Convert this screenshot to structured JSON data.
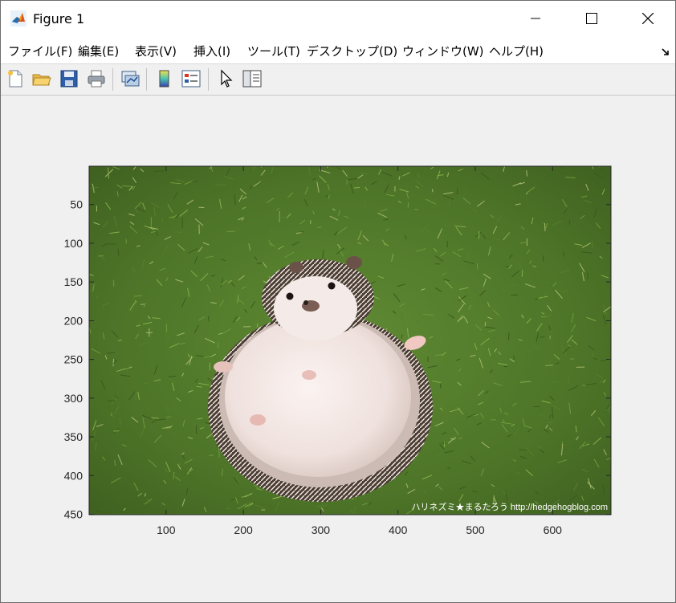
{
  "window": {
    "title": "Figure 1",
    "icon": "matlab-logo-icon",
    "controls": [
      "minimize-icon",
      "maximize-icon",
      "close-icon"
    ]
  },
  "menu": {
    "items": [
      {
        "label": "ファイル(F)"
      },
      {
        "label": "編集(E)"
      },
      {
        "label": "表示(V)"
      },
      {
        "label": "挿入(I)"
      },
      {
        "label": "ツール(T)"
      },
      {
        "label": "デスクトップ(D)"
      },
      {
        "label": "ウィンドウ(W)"
      },
      {
        "label": "ヘルプ(H)"
      }
    ],
    "dock_icon": "dock-arrow-icon"
  },
  "toolbar": {
    "buttons": [
      {
        "name": "new-figure-button",
        "icon": "new-document-icon"
      },
      {
        "name": "open-file-button",
        "icon": "open-folder-icon"
      },
      {
        "name": "save-figure-button",
        "icon": "floppy-disk-icon"
      },
      {
        "name": "print-figure-button",
        "icon": "printer-icon"
      },
      {
        "name": "link-plot-button",
        "icon": "link-plot-icon"
      },
      {
        "name": "insert-colorbar-button",
        "icon": "colorbar-icon"
      },
      {
        "name": "insert-legend-button",
        "icon": "legend-icon"
      },
      {
        "name": "edit-plot-button",
        "icon": "arrow-cursor-icon"
      },
      {
        "name": "property-inspector-button",
        "icon": "property-panel-icon"
      }
    ]
  },
  "plot": {
    "image_description": "",
    "image_subject_icon": "hedgehog-photo",
    "watermark": "ハリネズミ★まるたろう http://hedgehogblog.com",
    "xlim": [
      0.5,
      675.5
    ],
    "ylim": [
      0.5,
      450.5
    ],
    "y_direction": "reverse",
    "xticks": [
      100,
      200,
      300,
      400,
      500,
      600
    ],
    "yticks": [
      50,
      100,
      150,
      200,
      250,
      300,
      350,
      400,
      450
    ],
    "colors": {
      "grass": "#4f7a2a",
      "hedgehog_body": "#efe3df",
      "spines": "#5a4a3e",
      "axis": "#262626"
    }
  }
}
